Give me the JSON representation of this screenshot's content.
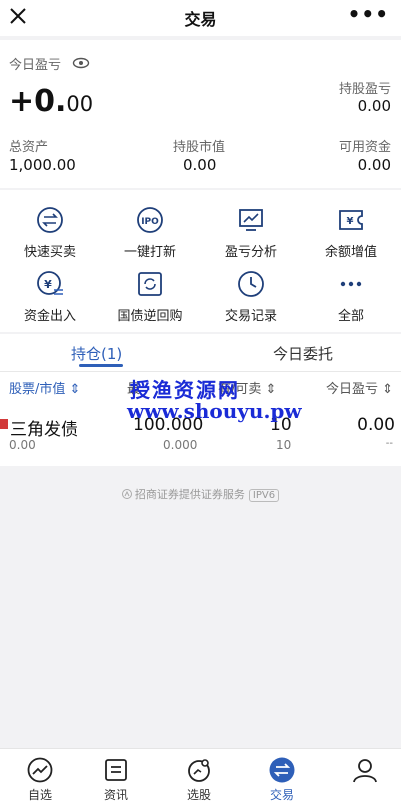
{
  "header": {
    "title": "交易",
    "more": "•••"
  },
  "summary": {
    "today_pnl_label": "今日盈亏",
    "today_pnl_int": "+0.",
    "today_pnl_dec": "00",
    "holding_pnl_label": "持股盈亏",
    "holding_pnl_value": "0.00",
    "total_assets_label": "总资产",
    "total_assets_value": "1,000.00",
    "market_value_label": "持股市值",
    "market_value_value": "0.00",
    "available_label": "可用资金",
    "available_value": "0.00"
  },
  "shortcuts": [
    {
      "label": "快速买卖",
      "icon": "swap-icon"
    },
    {
      "label": "一键打新",
      "icon": "ipo-icon"
    },
    {
      "label": "盈亏分析",
      "icon": "chart-icon"
    },
    {
      "label": "余额增值",
      "icon": "yen-ticket-icon"
    },
    {
      "label": "资金出入",
      "icon": "yen-transfer-icon"
    },
    {
      "label": "国债逆回购",
      "icon": "repo-icon"
    },
    {
      "label": "交易记录",
      "icon": "clock-icon"
    },
    {
      "label": "全部",
      "icon": "more-icon"
    }
  ],
  "tabs": [
    {
      "label": "持仓(1)"
    },
    {
      "label": "今日委托"
    }
  ],
  "table": {
    "headers": [
      "股票/市值 ⇕",
      "最",
      "有/可卖 ⇕",
      "今日盈亏 ⇕"
    ],
    "rows": [
      {
        "name": "三角发债",
        "market_value": "0.00",
        "price": "100.000",
        "cost": "0.000",
        "holding": "10",
        "available": "10",
        "pnl": "0.00",
        "pnl_sub": "--"
      }
    ]
  },
  "watermark": {
    "line1": "授渔资源网",
    "line2": "www.shouyu.pw"
  },
  "footer": {
    "note": "招商证券提供证券服务",
    "badge": "IPV6"
  },
  "bottom_nav": [
    {
      "label": "自选",
      "icon": "trend-icon"
    },
    {
      "label": "资讯",
      "icon": "news-icon"
    },
    {
      "label": "选股",
      "icon": "pick-icon"
    },
    {
      "label": "交易",
      "icon": "trade-icon"
    },
    {
      "label": "",
      "icon": "profile-icon"
    }
  ],
  "colors": {
    "accent": "#2e5fb8",
    "watermark": "#1a2bd6"
  }
}
